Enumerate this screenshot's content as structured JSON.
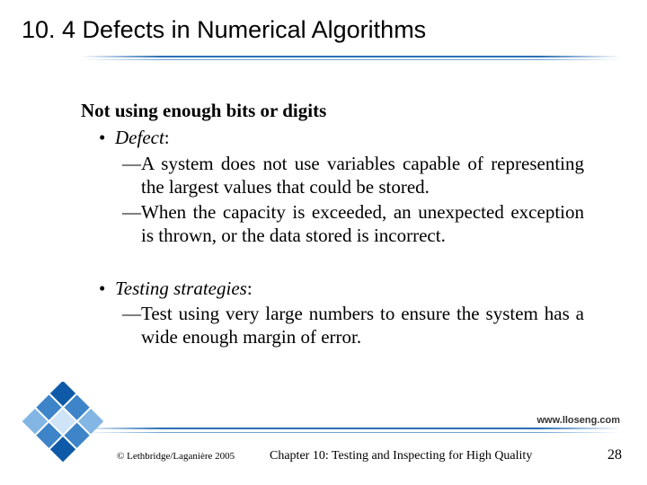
{
  "title": "10. 4 Defects in Numerical Algorithms",
  "heading": "Not using enough bits or digits",
  "bullet1_label": "Defect",
  "bullet1_colon": ":",
  "dash1a": "A system does not use variables capable of representing the largest values that could be stored.",
  "dash1b": "When the capacity is exceeded, an unexpected exception is thrown, or  the data stored is incorrect.",
  "bullet2_label": "Testing strategies",
  "bullet2_colon": ":",
  "dash2a": "Test using very large numbers to ensure the system has a wide enough margin of error.",
  "url": "www.lloseng.com",
  "copyright": "© Lethbridge/Laganière 2005",
  "chapter": "Chapter 10: Testing and Inspecting for High Quality",
  "page": "28",
  "bullet_char": "•",
  "dash_char": "—"
}
